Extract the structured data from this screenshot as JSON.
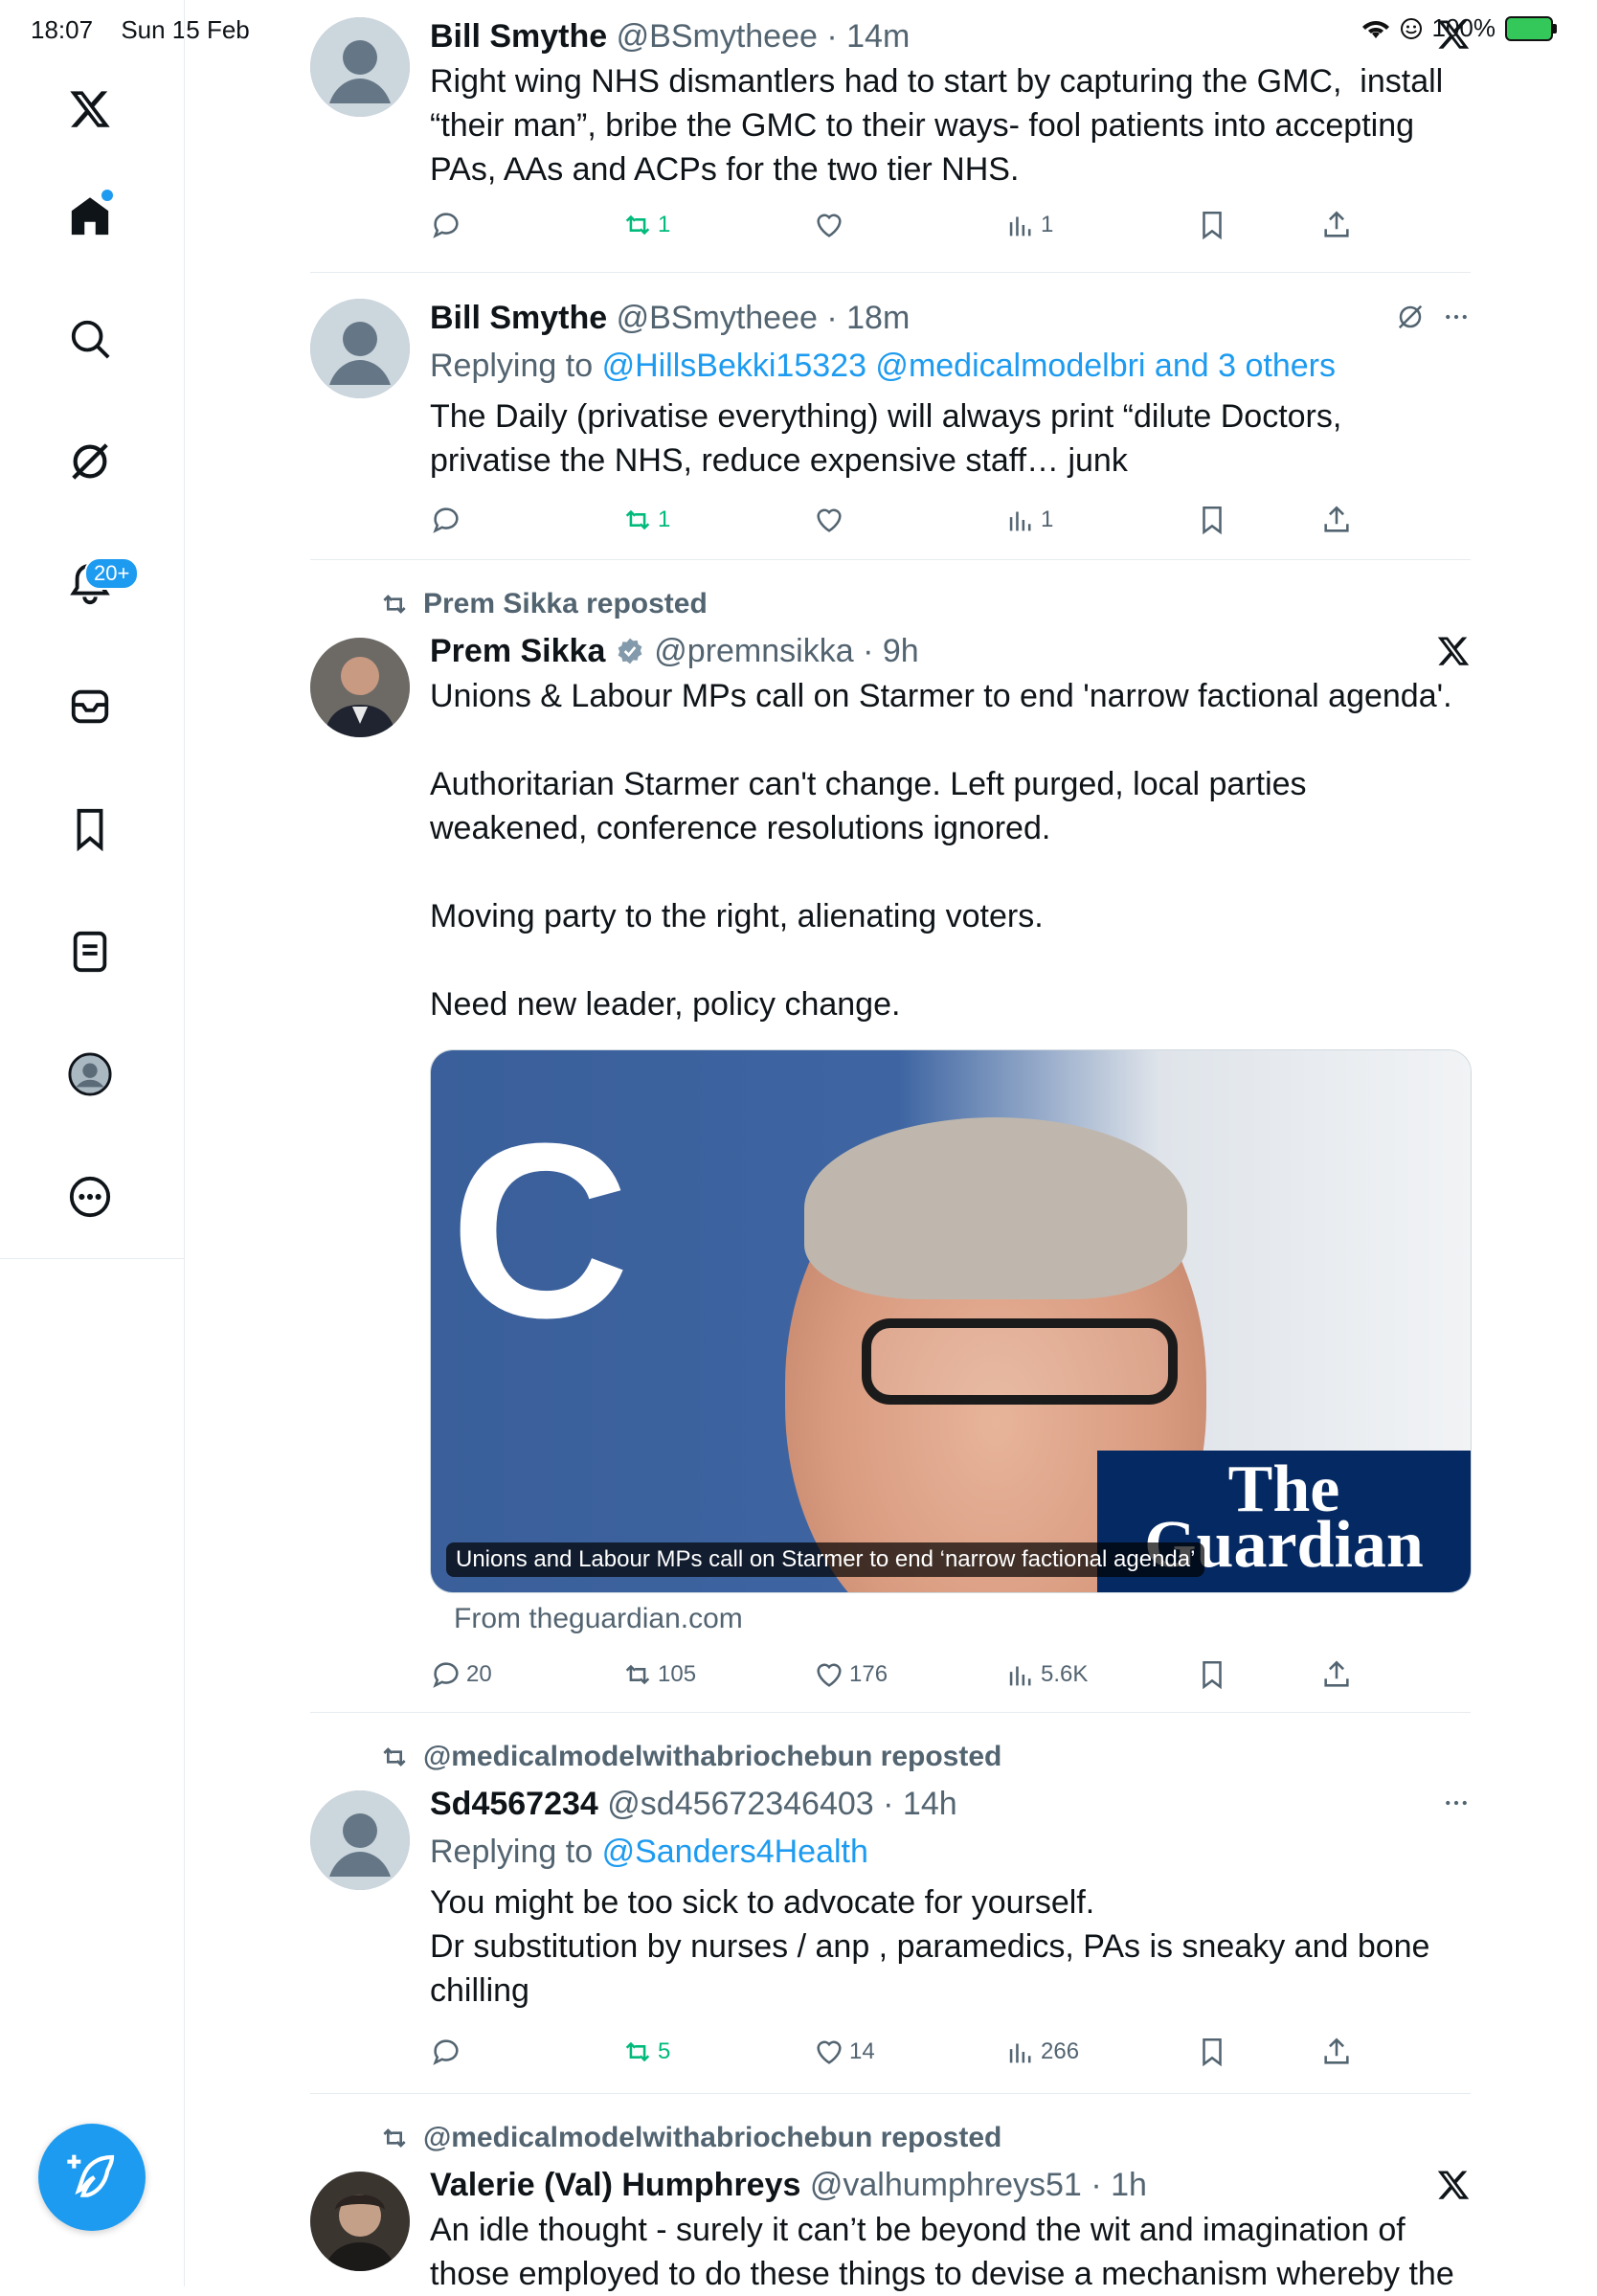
{
  "status_bar": {
    "time": "18:07",
    "date": "Sun 15 Feb",
    "battery": "100%"
  },
  "sidebar": {
    "notifications_badge": "20+"
  },
  "posts": [
    {
      "name": "Bill Smythe",
      "handle": "@BSmytheee",
      "time": "· 14m",
      "text": "Right wing NHS dismantlers had to start by capturing the GMC,  install “their man”, bribe the GMC to their ways- fool patients into accepting PAs, AAs and ACPs for the two tier NHS.",
      "retweets": "1",
      "views": "1"
    },
    {
      "name": "Bill Smythe",
      "handle": "@BSmytheee",
      "time": "· 18m",
      "replying_prefix": "Replying to",
      "replying_to": "@HillsBekki15323 @medicalmodelbri and 3 others",
      "text": "The Daily (privatise everything) will always print “dilute Doctors, privatise the NHS, reduce expensive staff… junk",
      "retweets": "1",
      "views": "1"
    },
    {
      "reposted_by": "Prem Sikka reposted",
      "name": "Prem Sikka",
      "handle": "@premnsikka",
      "time": "· 9h",
      "text": "Unions & Labour MPs call on Starmer to end 'narrow factional agenda'.\n\nAuthoritarian Starmer can't change. Left purged, local parties weakened, conference resolutions ignored.\n\nMoving party to the right, alienating voters.\n\nNeed new leader, policy change.",
      "card_caption": "Unions and Labour MPs call on Starmer to end ‘narrow factional agenda’",
      "card_logo": "The Guardian",
      "card_source": "From theguardian.com",
      "replies": "20",
      "retweets": "105",
      "likes": "176",
      "views": "5.6K"
    },
    {
      "reposted_by": "@medicalmodelwithabriochebun reposted",
      "name": "Sd4567234",
      "handle": "@sd45672346403",
      "time": "· 14h",
      "replying_prefix": "Replying to",
      "replying_to": "@Sanders4Health",
      "text": "You might be too sick to advocate for yourself.\nDr substitution by nurses / anp , paramedics, PAs is sneaky and bone chilling",
      "retweets": "5",
      "likes": "14",
      "views": "266"
    },
    {
      "reposted_by": "@medicalmodelwithabriochebun reposted",
      "name": "Valerie (Val) Humphreys",
      "handle": "@valhumphreys51",
      "time": "· 1h",
      "text": "An idle thought - surely it can’t be beyond the wit and imagination of those employed to do these things to devise a mechanism whereby the"
    }
  ],
  "colors": {
    "accent": "#1d9bf0",
    "retweet_green": "#00ba7c",
    "muted": "#536471",
    "guardian_blue": "#052962"
  }
}
